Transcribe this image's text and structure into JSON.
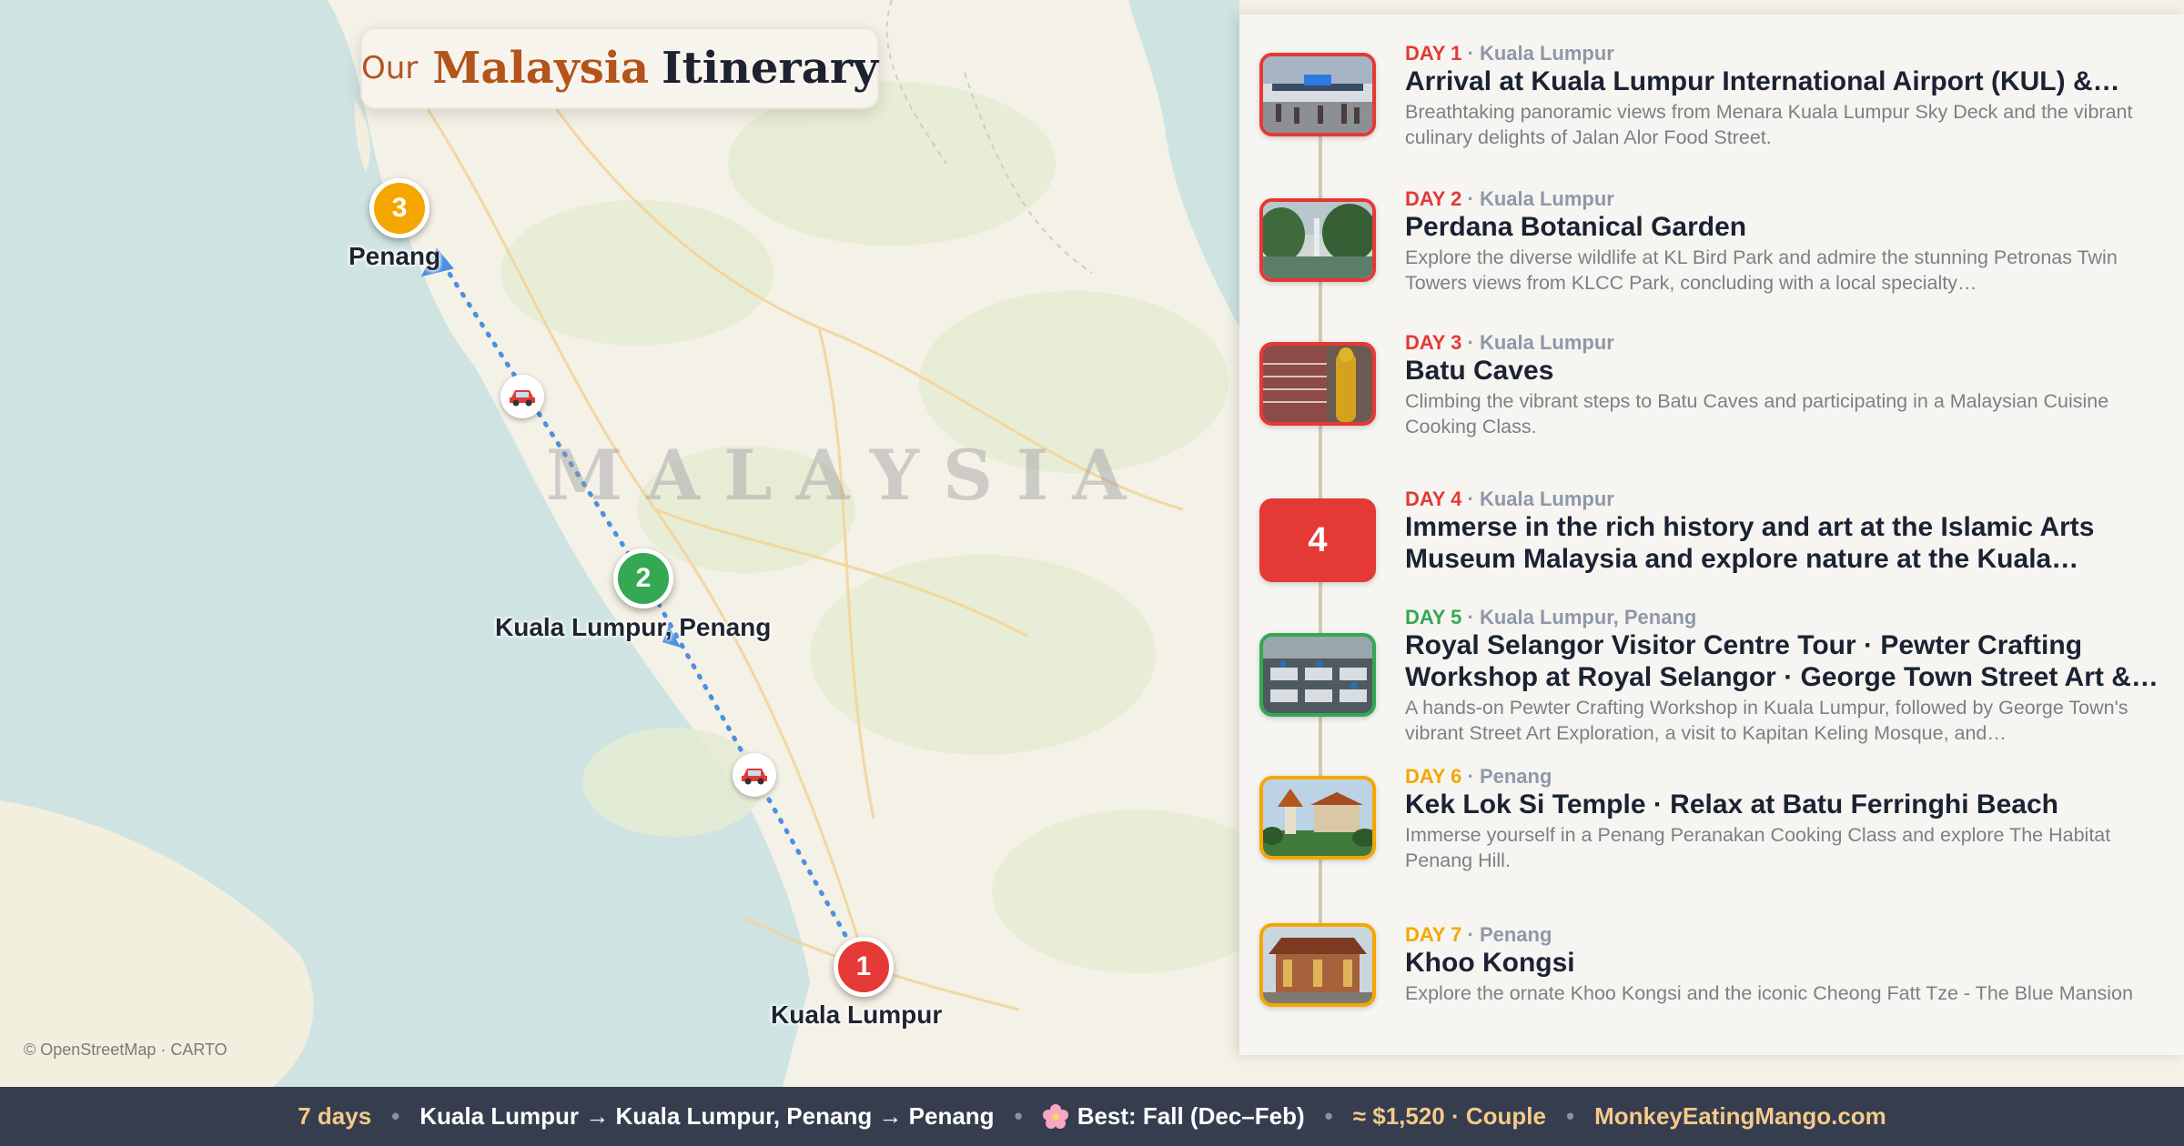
{
  "map": {
    "title": {
      "prefix": "Our",
      "country": "Malaysia",
      "word": "Itinerary"
    },
    "watermark": "MALAYSIA",
    "attribution": "© OpenStreetMap · CARTO",
    "transport_icon": "car-icon",
    "stops": [
      {
        "number": "1",
        "label": "Kuala Lumpur",
        "color": "#e53935"
      },
      {
        "number": "2",
        "label": "Kuala Lumpur, Penang",
        "color": "#34a853"
      },
      {
        "number": "3",
        "label": "Penang",
        "color": "#f5a700"
      }
    ]
  },
  "itinerary": [
    {
      "day": "DAY 1",
      "place": "Kuala Lumpur",
      "color": "#e53935",
      "title": "Arrival at Kuala Lumpur International Airport (KUL) &…",
      "desc": "Breathtaking panoramic views from Menara Kuala Lumpur Sky Deck and the vibrant culinary delights of Jalan Alor Food Street."
    },
    {
      "day": "DAY 2",
      "place": "Kuala Lumpur",
      "color": "#e53935",
      "title": "Perdana Botanical Garden",
      "desc": "Explore the diverse wildlife at KL Bird Park and admire the stunning Petronas Twin Towers views from KLCC Park, concluding with a local specialty…"
    },
    {
      "day": "DAY 3",
      "place": "Kuala Lumpur",
      "color": "#e53935",
      "title": "Batu Caves",
      "desc": "Climbing the vibrant steps to Batu Caves and participating in a Malaysian Cuisine Cooking Class."
    },
    {
      "day": "DAY 4",
      "place": "Kuala Lumpur",
      "color": "#e53935",
      "badge": "4",
      "title": "Immerse in the rich history and art at the Islamic Arts Museum Malaysia and explore nature at the Kuala Lumpur…",
      "desc": ""
    },
    {
      "day": "DAY 5",
      "place": "Kuala Lumpur, Penang",
      "color": "#34a853",
      "title": "Royal Selangor Visitor Centre Tour · Pewter Crafting Workshop at Royal Selangor · George Town Street Art &…",
      "desc": "A hands-on Pewter Crafting Workshop in Kuala Lumpur, followed by George Town's vibrant Street Art Exploration, a visit to Kapitan Keling Mosque, and…"
    },
    {
      "day": "DAY 6",
      "place": "Penang",
      "color": "#f5a700",
      "title": "Kek Lok Si Temple · Relax at Batu Ferringhi Beach",
      "desc": "Immerse yourself in a Penang Peranakan Cooking Class and explore The Habitat Penang Hill."
    },
    {
      "day": "DAY 7",
      "place": "Penang",
      "color": "#f5a700",
      "title": "Khoo Kongsi",
      "desc": "Explore the ornate Khoo Kongsi and the iconic Cheong Fatt Tze - The Blue Mansion"
    }
  ],
  "footer": {
    "days": "7 days",
    "route": "Kuala Lumpur → Kuala Lumpur, Penang → Penang",
    "best_icon": "cherry-blossom-icon",
    "best": "Best: Fall (Dec–Feb)",
    "cost": "≈ $1,520 · Couple",
    "site": "MonkeyEatingMango.com"
  }
}
